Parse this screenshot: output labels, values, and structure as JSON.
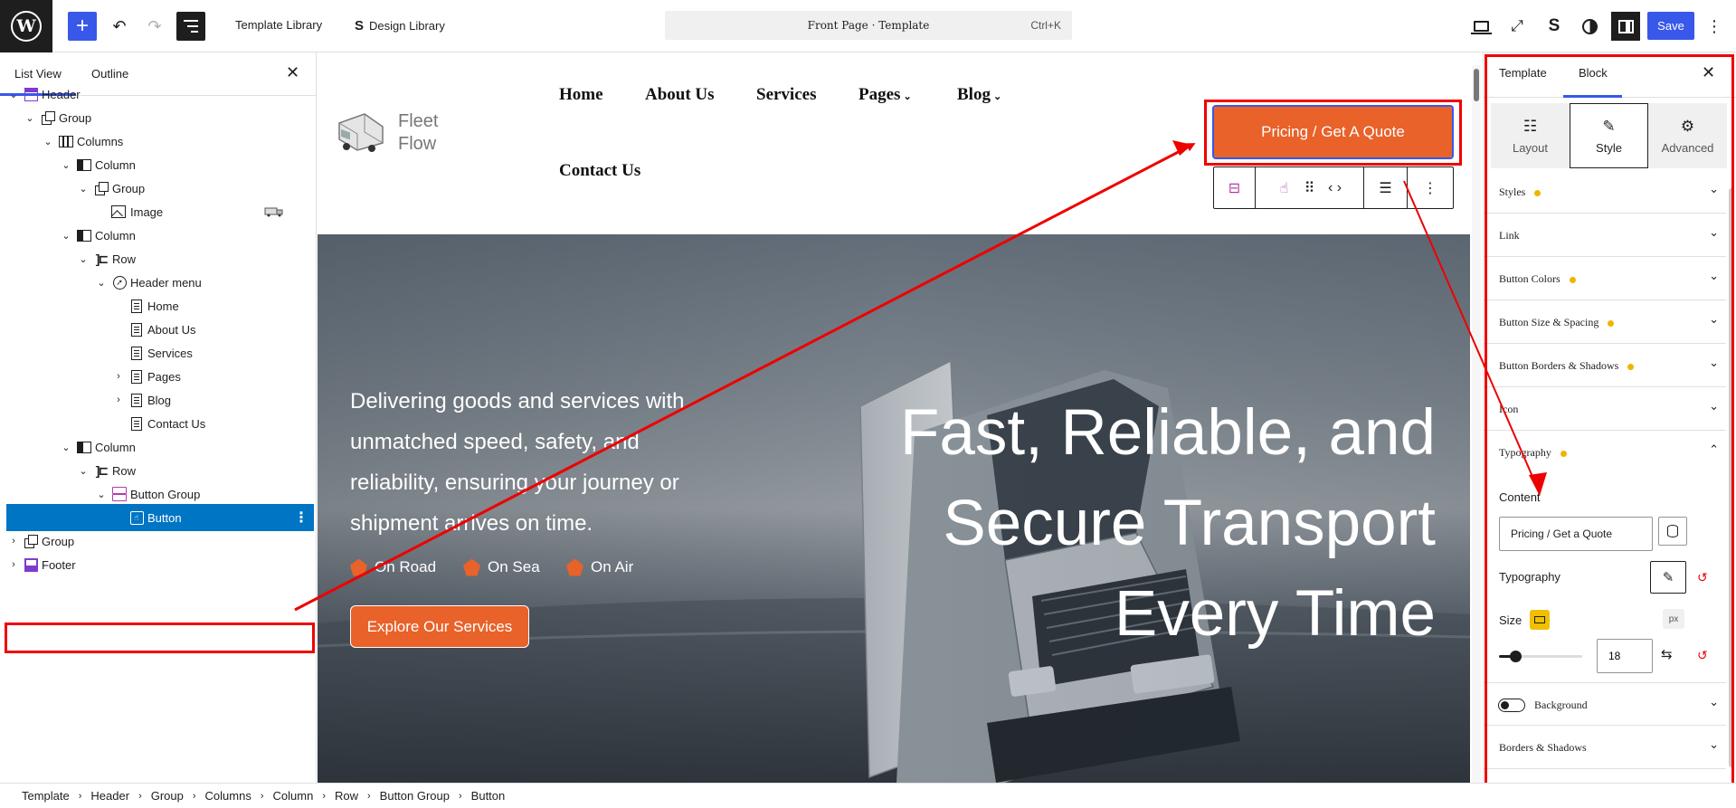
{
  "topbar": {
    "logo_letter": "W",
    "add_icon": "plus-icon",
    "undo_icon": "undo-icon",
    "redo_icon": "redo-icon",
    "document_overview_icon": "list-view-icon",
    "template_library_label": "Template Library",
    "design_library_label": "Design Library",
    "command_title": "Front Page · Template",
    "command_shortcut": "Ctrl+K",
    "save_label": "Save",
    "accent_color": "#3858e9"
  },
  "left_panel": {
    "tabs": [
      "List View",
      "Outline"
    ],
    "active_tab": "List View",
    "tree": [
      {
        "label": "Header",
        "icon": "template-part-header-icon",
        "depth": 0,
        "expanded": true
      },
      {
        "label": "Group",
        "icon": "group-icon",
        "depth": 1,
        "expanded": true
      },
      {
        "label": "Columns",
        "icon": "columns-icon",
        "depth": 2,
        "expanded": true
      },
      {
        "label": "Column",
        "icon": "column-icon",
        "depth": 3,
        "expanded": true
      },
      {
        "label": "Group",
        "icon": "group-icon",
        "depth": 4,
        "expanded": true
      },
      {
        "label": "Image",
        "icon": "image-icon",
        "depth": 5
      },
      {
        "label": "Column",
        "icon": "column-icon",
        "depth": 3,
        "expanded": true
      },
      {
        "label": "Row",
        "icon": "row-icon",
        "depth": 4,
        "expanded": true
      },
      {
        "label": "Header menu",
        "icon": "navigation-icon",
        "depth": 5,
        "expanded": true
      },
      {
        "label": "Home",
        "icon": "page-icon",
        "depth": 6
      },
      {
        "label": "About Us",
        "icon": "page-icon",
        "depth": 6
      },
      {
        "label": "Services",
        "icon": "page-icon",
        "depth": 6
      },
      {
        "label": "Pages",
        "icon": "page-icon",
        "depth": 6,
        "expanded": false
      },
      {
        "label": "Blog",
        "icon": "page-icon",
        "depth": 6,
        "expanded": false
      },
      {
        "label": "Contact Us",
        "icon": "page-icon",
        "depth": 6
      },
      {
        "label": "Column",
        "icon": "column-icon",
        "depth": 3,
        "expanded": true
      },
      {
        "label": "Row",
        "icon": "row-icon",
        "depth": 4,
        "expanded": true
      },
      {
        "label": "Button Group",
        "icon": "button-group-icon",
        "depth": 5,
        "expanded": true
      },
      {
        "label": "Button",
        "icon": "button-icon",
        "depth": 6,
        "selected": true
      },
      {
        "label": "Group",
        "icon": "group-icon",
        "depth": 0,
        "expanded": false
      },
      {
        "label": "Footer",
        "icon": "template-part-footer-icon",
        "depth": 0,
        "expanded": false
      }
    ]
  },
  "canvas": {
    "site_name": "Fleet Flow",
    "nav": [
      "Home",
      "About Us",
      "Services",
      "Pages",
      "Blog",
      "Contact Us"
    ],
    "quote_button": "Pricing / Get A Quote",
    "hero_tagline": "Delivering goods and services with unmatched speed, safety, and reliability, ensuring your journey or shipment arrives on time.",
    "hero_features": [
      "On Road",
      "On Sea",
      "On Air"
    ],
    "hero_cta": "Explore Our Services",
    "hero_title": "Fast, Reliable, and Secure Transport Every Time",
    "brand_color": "#e8622a"
  },
  "right_panel": {
    "tabs": [
      "Template",
      "Block"
    ],
    "active_tab": "Block",
    "segments": [
      {
        "label": "Layout",
        "icon": "layout-icon"
      },
      {
        "label": "Style",
        "icon": "paintbrush-icon"
      },
      {
        "label": "Advanced",
        "icon": "gear-icon"
      }
    ],
    "active_segment": "Style",
    "accordions_top": [
      {
        "label": "Styles",
        "modified": true
      },
      {
        "label": "Link",
        "modified": false
      },
      {
        "label": "Button Colors",
        "modified": true
      },
      {
        "label": "Button Size & Spacing",
        "modified": true
      },
      {
        "label": "Button Borders & Shadows",
        "modified": true
      },
      {
        "label": "Icon",
        "modified": false
      },
      {
        "label": "Typography",
        "modified": true,
        "expanded": true
      }
    ],
    "content_label": "Content",
    "content_value": "Pricing / Get a Quote",
    "typography_label": "Typography",
    "size_label": "Size",
    "size_unit": "px",
    "size_value": "18",
    "size_slider_fraction": 0.2,
    "accordions_bottom": [
      {
        "label": "Background",
        "has_toggle": true
      },
      {
        "label": "Borders & Shadows",
        "has_toggle": false
      }
    ],
    "modified_dot_color": "#f0b400"
  },
  "breadcrumb": [
    "Template",
    "Header",
    "Group",
    "Columns",
    "Column",
    "Row",
    "Button Group",
    "Button"
  ],
  "annotation_color": "#e00000"
}
